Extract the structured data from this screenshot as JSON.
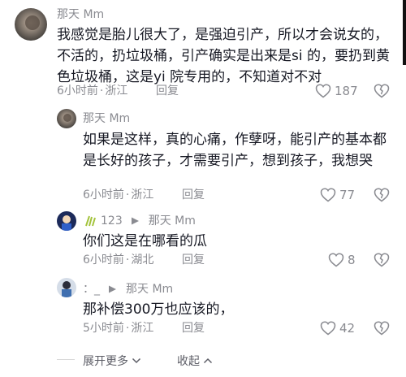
{
  "comments": [
    {
      "username": "那天 Mm",
      "text": "我感觉是胎儿很大了，是强迫引产，所以才会说女的，不活的，扔垃圾桶，引产确实是出来是si 的，要扔到黄色垃圾桶，这是yi 院专用的，不知道对不对",
      "time": "6小时前",
      "location": "浙江",
      "reply_label": "回复",
      "likes": "187"
    },
    {
      "username": "那天 Mm",
      "text": "如果是这样，真的心痛，作孽呀，能引产的基本都是长好的孩子，才需要引产，想到孩子，我想哭",
      "time": "6小时前",
      "location": "浙江",
      "reply_label": "回复",
      "likes": "77"
    },
    {
      "username_prefix": "123",
      "username": "那天 Mm",
      "text": "你们这是在哪看的瓜",
      "time": "6小时前",
      "location": "湖北",
      "reply_label": "回复",
      "likes": "8"
    },
    {
      "username_prefix": "：_",
      "username": "那天 Mm",
      "text": "那补偿300万也应该的，",
      "time": "5小时前",
      "location": "浙江",
      "reply_label": "回复",
      "likes": "42"
    }
  ],
  "separator": "·",
  "footer": {
    "expand_label": "展开更多",
    "collapse_label": "收起"
  }
}
